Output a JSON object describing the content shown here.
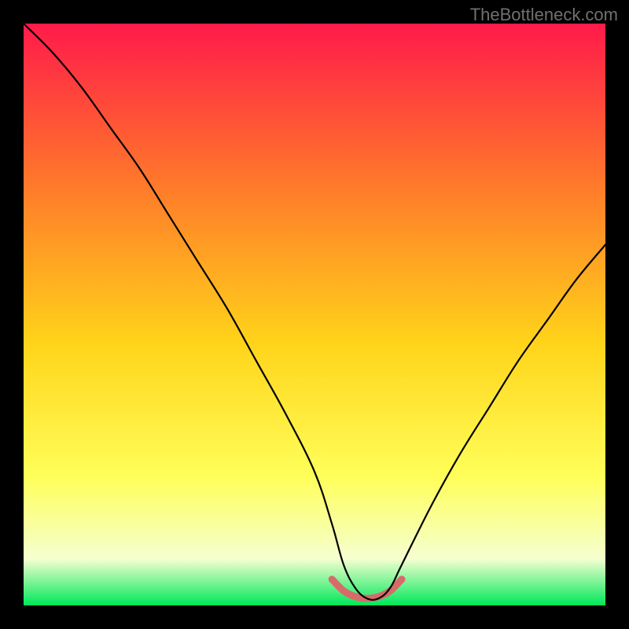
{
  "watermark": "TheBottleneck.com",
  "chart_data": {
    "type": "line",
    "title": "",
    "xlabel": "",
    "ylabel": "",
    "xlim": [
      0,
      100
    ],
    "ylim": [
      0,
      100
    ],
    "gradient_colors": {
      "top": "#ff1a4a",
      "upper_mid": "#ff7a2a",
      "mid": "#ffd41a",
      "lower_mid": "#ffff5a",
      "lower": "#f5ffd0",
      "bottom": "#00e85a"
    },
    "series": [
      {
        "name": "bottleneck-curve",
        "color": "#000000",
        "width": 2.2,
        "x": [
          0,
          5,
          10,
          15,
          20,
          25,
          30,
          35,
          40,
          45,
          50,
          53,
          55,
          57,
          59,
          61,
          63,
          65,
          70,
          75,
          80,
          85,
          90,
          95,
          100
        ],
        "y": [
          100,
          95,
          89,
          82,
          75,
          67,
          59,
          51,
          42,
          33,
          23,
          14,
          7,
          3,
          1.2,
          1.2,
          3,
          7,
          17,
          26,
          34,
          42,
          49,
          56,
          62
        ]
      },
      {
        "name": "optimal-band",
        "color": "#d86a6a",
        "width": 9,
        "x": [
          53,
          55,
          57,
          59,
          61,
          63,
          65
        ],
        "y": [
          4.5,
          2.5,
          1.5,
          1.2,
          1.5,
          2.5,
          4.5
        ]
      }
    ]
  }
}
